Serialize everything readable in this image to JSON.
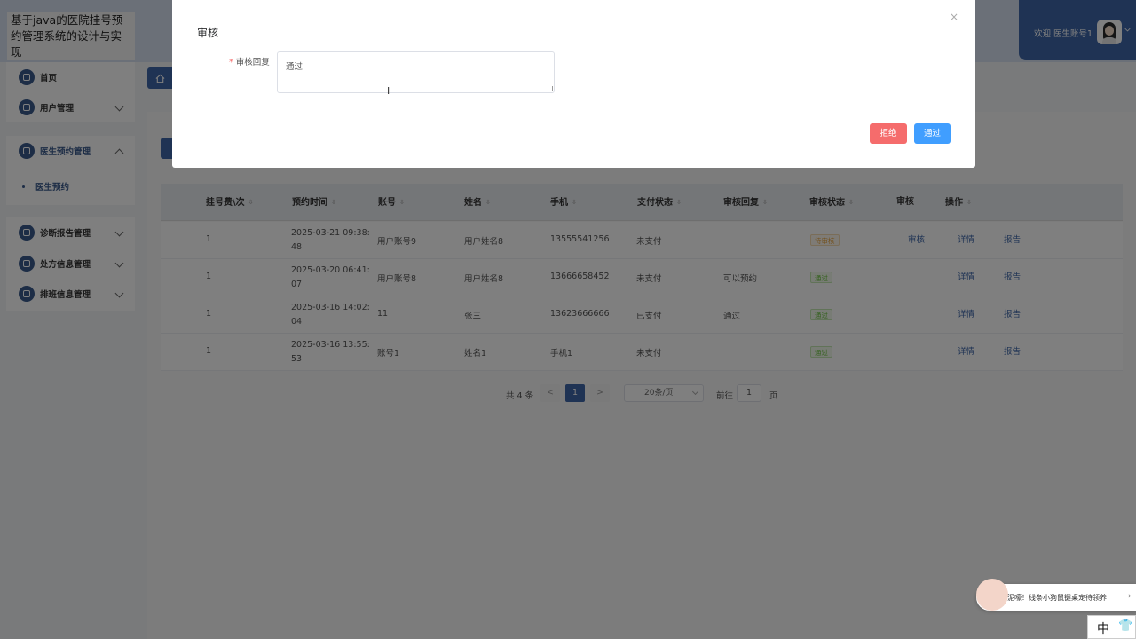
{
  "app": {
    "title": "基于java的医院挂号预约管理系统的设计与实现"
  },
  "header": {
    "welcome": "欢迎 医生账号1"
  },
  "sidebar": {
    "home": "首页",
    "user_mgmt": "用户管理",
    "doctor_appt_mgmt": "医生预约管理",
    "doctor_appt": "医生预约",
    "diag_report_mgmt": "诊断报告管理",
    "prescription_mgmt": "处方信息管理",
    "schedule_mgmt": "排班信息管理"
  },
  "breadcrumb": {
    "home_icon": "home-icon"
  },
  "table": {
    "headers": [
      "挂号费\\次",
      "预约时间",
      "账号",
      "姓名",
      "手机",
      "支付状态",
      "审核回复",
      "审核状态",
      "审核",
      "操作"
    ],
    "rows": [
      {
        "fee": "1",
        "time1": "2025-03-21 09:38:",
        "time2": "48",
        "account": "用户账号9",
        "name": "用户姓名8",
        "phone": "13555541256",
        "pay": "未支付",
        "reply": "",
        "status": "待审核",
        "status_type": "pending",
        "audit": "审核",
        "detail": "详情",
        "report": "报告"
      },
      {
        "fee": "1",
        "time1": "2025-03-20 06:41:",
        "time2": "07",
        "account": "用户账号8",
        "name": "用户姓名8",
        "phone": "13666658452",
        "pay": "未支付",
        "reply": "可以预约",
        "status": "通过",
        "status_type": "pass",
        "audit": "",
        "detail": "详情",
        "report": "报告"
      },
      {
        "fee": "1",
        "time1": "2025-03-16 14:02:",
        "time2": "04",
        "account": "11",
        "name": "张三",
        "phone": "13623666666",
        "pay": "已支付",
        "reply": "通过",
        "status": "通过",
        "status_type": "pass",
        "audit": "",
        "detail": "详情",
        "report": "报告"
      },
      {
        "fee": "1",
        "time1": "2025-03-16 13:55:",
        "time2": "53",
        "account": "账号1",
        "name": "姓名1",
        "phone": "手机1",
        "pay": "未支付",
        "reply": "",
        "status": "通过",
        "status_type": "pass",
        "audit": "",
        "detail": "详情",
        "report": "报告"
      }
    ]
  },
  "pagination": {
    "total": "共 4 条",
    "prev": "<",
    "current": "1",
    "next": ">",
    "page_size": "20条/页",
    "goto": "前往",
    "goto_value": "1",
    "page_unit": "页"
  },
  "dialog": {
    "title": "审核",
    "close": "×",
    "label": "审核回复",
    "required_mark": "*",
    "reply_value": "通过",
    "reject_label": "拒绝",
    "pass_label": "通过"
  },
  "notification": {
    "text": "泥嚎！线条小狗鼠键桌宠待领养",
    "arrow": "›"
  },
  "ime": {
    "mode": "中",
    "skin_icon": "shirt-icon"
  },
  "colors": {
    "primary": "#3e67a8",
    "danger": "#f56c6c",
    "info_blue": "#409eff",
    "warning": "#e6a23c",
    "success": "#67c23a"
  }
}
